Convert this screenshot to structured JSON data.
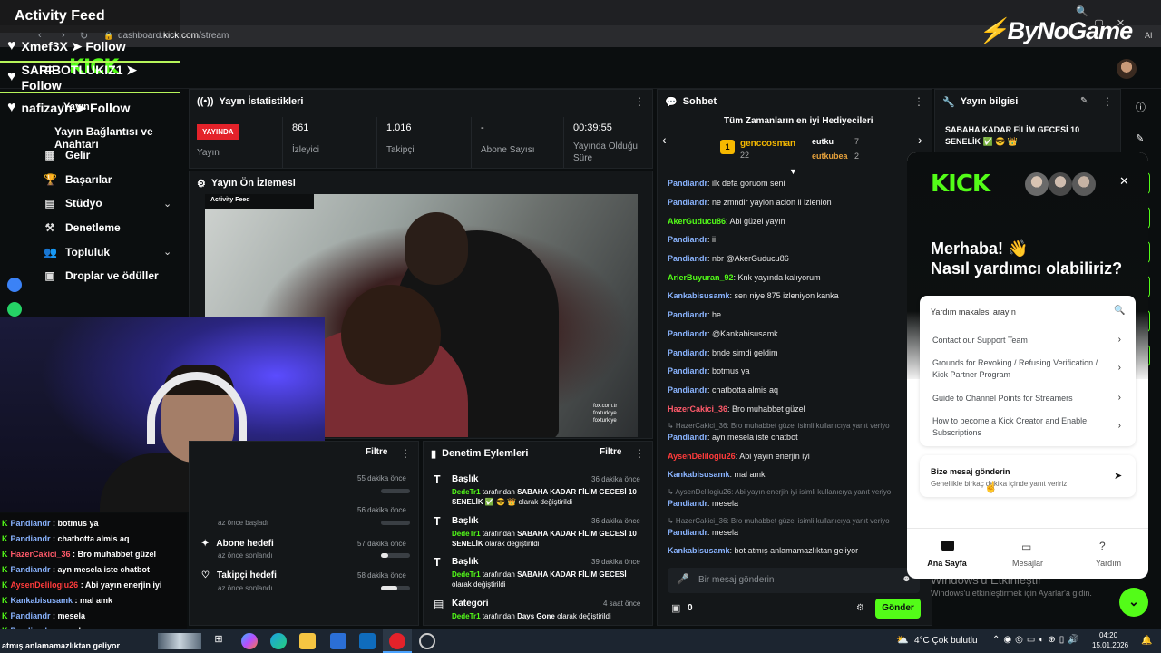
{
  "browser": {
    "url_prefix": "dashboard.",
    "url_domain": "kick.com",
    "url_path": "/stream",
    "watermark": "ByNoGame",
    "ai_label": "AI"
  },
  "activity_feed": {
    "title": "Activity Feed",
    "items": [
      {
        "text": "Xmef3X ➤ Follow"
      },
      {
        "text": "SARIBOTLUKIZ1 ➤ Follow"
      },
      {
        "text": "nafizayn ➤ Follow"
      }
    ]
  },
  "sidebar": {
    "partial_item": "Yayın",
    "items": [
      {
        "label": "Yayın Bağlantısı ve Anahtarı",
        "icon": ""
      },
      {
        "label": "Gelir",
        "icon": "revenue-icon"
      },
      {
        "label": "Başarılar",
        "icon": "trophy-icon"
      },
      {
        "label": "Stüdyo",
        "icon": "studio-icon"
      },
      {
        "label": "Denetleme",
        "icon": "gavel-icon"
      },
      {
        "label": "Topluluk",
        "icon": "community-icon"
      },
      {
        "label": "Droplar ve ödüller",
        "icon": "drops-icon"
      }
    ]
  },
  "stats": {
    "title": "Yayın İstatistikleri",
    "live_badge": "YAYINDA",
    "cells": [
      {
        "value": "",
        "label": "Yayın"
      },
      {
        "value": "861",
        "label": "İzleyici"
      },
      {
        "value": "1.016",
        "label": "Takipçi"
      },
      {
        "value": "-",
        "label": "Abone Sayısı"
      },
      {
        "value": "00:39:55",
        "label": "Yayında Olduğu Süre"
      }
    ]
  },
  "preview": {
    "title": "Yayın Ön İzlemesi",
    "inner_label": "Activity Feed",
    "watermark_lines": [
      "fox.com.tr",
      "foxturkiye",
      "foxturkiye"
    ]
  },
  "goals": {
    "filter_label": "Filtre",
    "items": [
      {
        "title": "",
        "sub": "",
        "time": "55 dakika önce",
        "fill": 0
      },
      {
        "title": "Abone hedefi",
        "sub": "az önce başladı",
        "time": "56 dakika önce",
        "fill": 0
      },
      {
        "title": "Abone hedefi",
        "sub": "az önce sonlandı",
        "time": "57 dakika önce",
        "fill": 0.25
      },
      {
        "title": "Takipçi hedefi",
        "sub": "az önce sonlandı",
        "time": "58 dakika önce",
        "fill": 0.55
      }
    ]
  },
  "moderation": {
    "title": "Denetim Eylemleri",
    "filter_label": "Filtre",
    "items": [
      {
        "title": "Başlık",
        "time": "36 dakika önce",
        "user": "DedeTr1",
        "mid": " tarafından ",
        "bold": "SABAHA KADAR FİLİM GECESİ 10 SENELİK ✅ 😎 👑",
        "end": " olarak değiştirildi"
      },
      {
        "title": "Başlık",
        "time": "36 dakika önce",
        "user": "DedeTr1",
        "mid": " tarafından ",
        "bold": "SABAHA KADAR FİLİM GECESİ 10 SENELİK",
        "end": " olarak değiştirildi"
      },
      {
        "title": "Başlık",
        "time": "39 dakika önce",
        "user": "DedeTr1",
        "mid": " tarafından ",
        "bold": "SABAHA KADAR FİLİM GECESİ",
        "end": " olarak değiştirildi"
      },
      {
        "title": "Kategori",
        "time": "4 saat önce",
        "user": "DedeTr1",
        "mid": " tarafından ",
        "bold": "Days Gone",
        "end": " olarak değiştirildi"
      }
    ]
  },
  "chat": {
    "title": "Sohbet",
    "gifters_title": "Tüm Zamanların en iyi Hediyecileri",
    "gifters": [
      {
        "name": "genccosman",
        "count": "22",
        "rank": "1"
      },
      {
        "name": "eutku",
        "count": "7"
      },
      {
        "name": "eutkubea",
        "count": "2"
      }
    ],
    "messages": [
      {
        "user": "Pandiandr",
        "text": ": ilk defa goruom seni",
        "color": "#8ab4ff"
      },
      {
        "user": "Pandiandr",
        "text": ": ne zmndir yayion acion ii izlenion",
        "color": "#8ab4ff"
      },
      {
        "user": "AkerGuducu86",
        "text": ": Abi güzel yayın",
        "color": "#53fc18"
      },
      {
        "user": "Pandiandr",
        "text": ": ii",
        "color": "#8ab4ff"
      },
      {
        "user": "Pandiandr",
        "text": ": nbr @AkerGuducu86",
        "color": "#8ab4ff"
      },
      {
        "user": "ArierBuyuran_92",
        "text": ": Knk yayında kalıyorum",
        "color": "#53fc18"
      },
      {
        "user": "Kankabisusamk",
        "text": ": sen niye 875 izleniyon kanka",
        "color": "#8ab4ff"
      },
      {
        "user": "Pandiandr",
        "text": ": he",
        "color": "#8ab4ff"
      },
      {
        "user": "Pandiandr",
        "text": ": @Kankabisusamk",
        "color": "#8ab4ff"
      },
      {
        "user": "Pandiandr",
        "text": ": bnde simdi geldim",
        "color": "#8ab4ff"
      },
      {
        "user": "Pandiandr",
        "text": ": botmus ya",
        "color": "#8ab4ff"
      },
      {
        "user": "Pandiandr",
        "text": ": chatbotta almis aq",
        "color": "#8ab4ff"
      },
      {
        "user": "HazerCakici_36",
        "text": ": Bro muhabbet güzel",
        "color": "#ff5a6a"
      }
    ],
    "reply1": "↳ HazerCakici_36: Bro muhabbet güzel isimli kullanıcıya yanıt veriyo",
    "msg_after_reply1": {
      "user": "Pandiandr",
      "text": ": ayn mesela iste chatbot",
      "color": "#8ab4ff"
    },
    "msg2": {
      "user": "AysenDelilogiu26",
      "text": ": Abi yayın enerjin iyi",
      "color": "#ff3b3b"
    },
    "msg3": {
      "user": "Kankabisusamk",
      "text": ": mal amk",
      "color": "#8ab4ff"
    },
    "reply2": "↳ AysenDelilogiu26: Abi yayın enerjin iyi isimli kullanıcıya yanıt veriyo",
    "msg_after_reply2": {
      "user": "Pandiandr",
      "text": ": mesela",
      "color": "#8ab4ff"
    },
    "reply3": "↳ HazerCakici_36: Bro muhabbet güzel isimli kullanıcıya yanıt veriyo",
    "msg_after_reply3": {
      "user": "Pandiandr",
      "text": ": mesela",
      "color": "#8ab4ff"
    },
    "msg_last": {
      "user": "Kankabisusamk",
      "text": ": bot atmış anlamamazlıktan geliyor",
      "color": "#8ab4ff"
    },
    "input_placeholder": "Bir mesaj gönderin",
    "points": "0",
    "send_label": "Gönder"
  },
  "stream_info": {
    "title": "Yayın bilgisi",
    "stream_title": "SABAHA KADAR FİLİM GECESİ 10 SENELİK ✅ 😎 👑"
  },
  "overlay_chat": [
    {
      "user": "Pandiandr",
      "text": " : botmus ya",
      "color": "#8ab4ff"
    },
    {
      "user": "Pandiandr",
      "text": " : chatbotta almis aq",
      "color": "#8ab4ff"
    },
    {
      "user": "HazerCakici_36",
      "text": " : Bro muhabbet güzel",
      "color": "#ff5a6a"
    },
    {
      "user": "Pandiandr",
      "text": " : ayn mesela iste chatbot",
      "color": "#8ab4ff"
    },
    {
      "user": "AysenDelilogiu26",
      "text": " : Abi yayın enerjin iyi",
      "color": "#ff3b3b"
    },
    {
      "user": "Kankabisusamk",
      "text": " : mal amk",
      "color": "#8ab4ff"
    },
    {
      "user": "Pandiandr",
      "text": " : mesela",
      "color": "#8ab4ff"
    },
    {
      "user": "Pandiandr",
      "text": " : mesela",
      "color": "#8ab4ff"
    }
  ],
  "overlay_bottom_text": "atmış anlamamazlıktan geliyor",
  "help": {
    "greeting1": "Merhaba! 👋",
    "greeting2": "Nasıl yardımcı olabiliriz?",
    "search_placeholder": "Yardım makalesi arayın",
    "links": [
      "Contact our Support Team",
      "Grounds for Revoking / Refusing Verification / Kick Partner Program",
      "Guide to Channel Points for Streamers",
      "How to become a Kick Creator and Enable Subscriptions"
    ],
    "msg_title": "Bize mesaj gönderin",
    "msg_sub": "Genellikle birkaç dakika içinde yanıt veririz",
    "tabs": [
      "Ana Sayfa",
      "Mesajlar",
      "Yardım"
    ]
  },
  "windows_activation": {
    "line1": "Windows'u Etkinleştir",
    "line2": "Windows'u etkinleştirmek için Ayarlar'a gidin."
  },
  "taskbar": {
    "weather": "4°C  Çok bulutlu",
    "time": "04:20",
    "date": "15.01.2026"
  },
  "logo_text": "KICK",
  "colors": {
    "brand": "#53fc18",
    "live": "#e4222a"
  }
}
